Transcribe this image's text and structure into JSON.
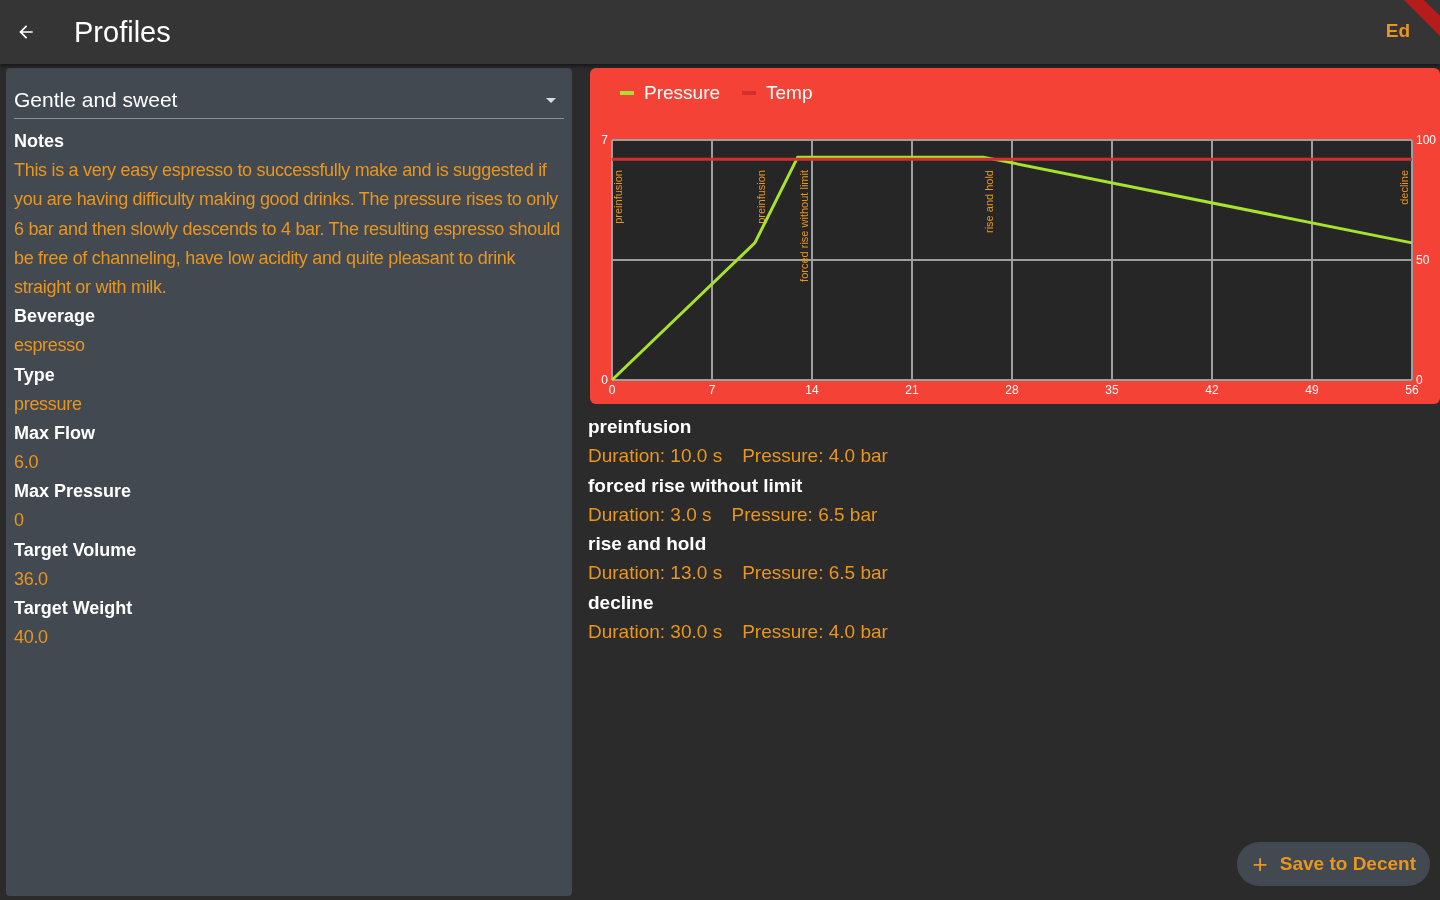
{
  "app_bar": {
    "title": "Profiles",
    "action": "Ed"
  },
  "profile_select": {
    "value": "Gentle and sweet"
  },
  "fields": [
    {
      "label": "Notes",
      "value": "This is a very easy espresso to successfully make and is suggested if you are having difficulty making good drinks.  The pressure rises to only 6 bar and then slowly descends to 4 bar.  The resulting espresso should be free of channeling, have low acidity and quite pleasant to drink straight or with milk."
    },
    {
      "label": "Beverage",
      "value": "espresso"
    },
    {
      "label": "Type",
      "value": "pressure"
    },
    {
      "label": "Max Flow",
      "value": "6.0"
    },
    {
      "label": "Max Pressure",
      "value": "0"
    },
    {
      "label": "Target Volume",
      "value": "36.0"
    },
    {
      "label": "Target Weight",
      "value": "40.0"
    }
  ],
  "chart_data": {
    "type": "line",
    "x": [
      0,
      10,
      13,
      26,
      56
    ],
    "series": [
      {
        "name": "Pressure",
        "color": "#a6e22e",
        "values": [
          0,
          4,
          6.5,
          6.5,
          4
        ]
      },
      {
        "name": "Temp",
        "color": "#d32f2f",
        "values": [
          92,
          92,
          92,
          92,
          92
        ],
        "axis": "y2"
      }
    ],
    "xlim": [
      0,
      56
    ],
    "ylim": [
      0,
      7
    ],
    "xticks": [
      0,
      7,
      14,
      21,
      28,
      35,
      42,
      49,
      56
    ],
    "yticks": [
      0,
      7
    ],
    "y2lim": [
      0,
      100
    ],
    "grid": true,
    "legend": "top-left",
    "y2ticks": [
      0,
      50,
      100
    ],
    "annotations": [
      "preinfusion",
      "preinfusion",
      "forced rise without limit",
      "rise and hold",
      "decline"
    ]
  },
  "stages": [
    {
      "name": "preinfusion",
      "duration": "Duration: 10.0 s",
      "pressure": "Pressure: 4.0 bar"
    },
    {
      "name": "forced rise without limit",
      "duration": "Duration: 3.0 s",
      "pressure": "Pressure: 6.5 bar"
    },
    {
      "name": "rise and hold",
      "duration": "Duration: 13.0 s",
      "pressure": "Pressure: 6.5 bar"
    },
    {
      "name": "decline",
      "duration": "Duration: 30.0 s",
      "pressure": "Pressure: 4.0 bar"
    }
  ],
  "save_button": {
    "label": "Save to Decent",
    "icon": "+"
  }
}
